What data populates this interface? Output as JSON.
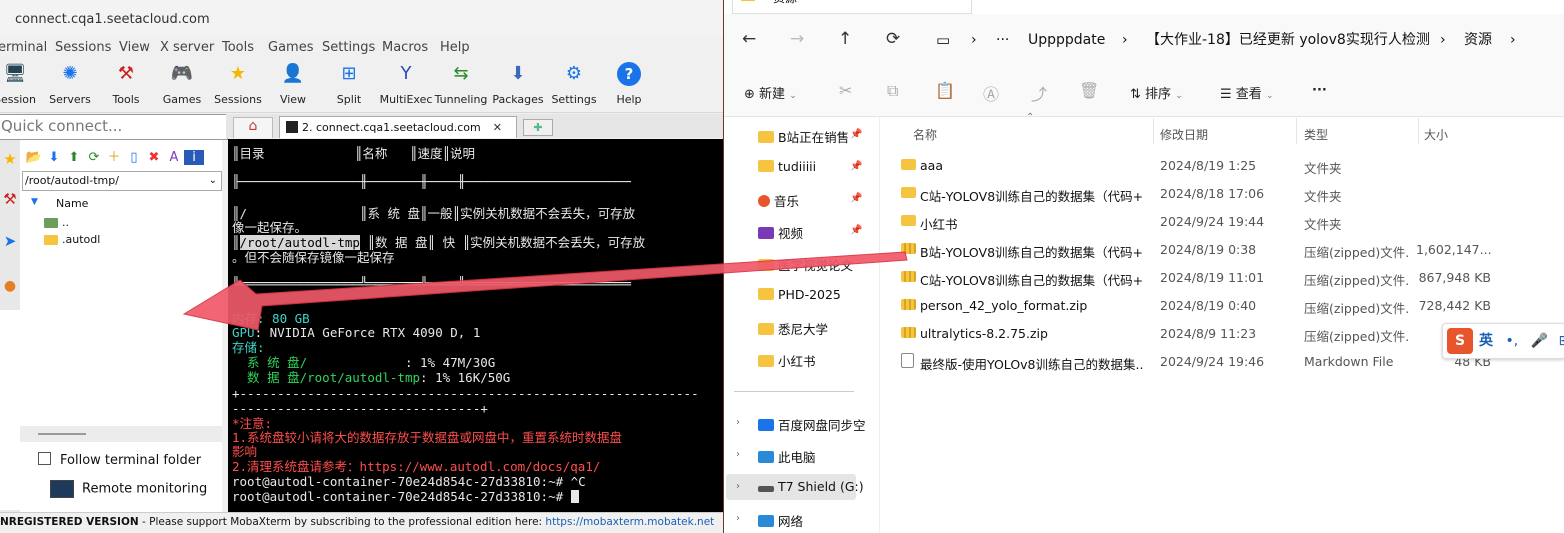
{
  "moba": {
    "title": "connect.cqa1.seetacloud.com",
    "menu": [
      "erminal",
      "Sessions",
      "View",
      "X server",
      "Tools",
      "Games",
      "Settings",
      "Macros",
      "Help"
    ],
    "toolbar": [
      {
        "label": "Session",
        "icon": "session-icon"
      },
      {
        "label": "Servers",
        "icon": "servers-icon"
      },
      {
        "label": "Tools",
        "icon": "tools-icon"
      },
      {
        "label": "Games",
        "icon": "games-icon"
      },
      {
        "label": "Sessions",
        "icon": "star-icon"
      },
      {
        "label": "View",
        "icon": "view-icon"
      },
      {
        "label": "Split",
        "icon": "split-icon"
      },
      {
        "label": "MultiExec",
        "icon": "multiexec-icon"
      },
      {
        "label": "Tunneling",
        "icon": "tunneling-icon"
      },
      {
        "label": "Packages",
        "icon": "packages-icon"
      },
      {
        "label": "Settings",
        "icon": "settings-icon"
      },
      {
        "label": "Help",
        "icon": "help-icon"
      }
    ],
    "quick_connect_placeholder": "Quick connect...",
    "sftp": {
      "path": "/root/autodl-tmp/",
      "column_name": "Name",
      "items": [
        "..",
        ".autodl"
      ],
      "follow_label": "Follow terminal folder",
      "remote_label": "Remote monitoring"
    },
    "tab_label": "2. connect.cqa1.seetacloud.com",
    "terminal": {
      "header": "║目录            ║名称   ║速度║说明",
      "sep1": "╟────────────────╫───────╫────╫──────────────────────",
      "row1a": "║/               ║系 统 盘║一般║实例关机数据不会丢失，可存放",
      "row1b": "像一起保存。",
      "row2a_path": "/root/autodl-tmp",
      "row2a_rest": "║数 据 盘║ 快 ║实例关机数据不会丢失，可存放",
      "row2b": "。但不会随保存镜像一起保存",
      "sep2": "╚════════════════╩═══════╩════╩══════════════════════",
      "mem": "内存: 80 GB",
      "gpu_label": "GPU",
      "gpu": ": NVIDIA GeForce RTX 4090 D, 1",
      "storage": "存储:",
      "sys_disk": "  系 统 盘/",
      "sys_usage": "             : 1% 47M/30G",
      "data_disk": "  数 据 盘/root/autodl-tmp",
      "data_usage": ": 1% 16K/50G",
      "sep3": "+-------------------------------------------------------------",
      "sep4": "---------------------------------+",
      "note_title": "*注意:",
      "note1": "1.系统盘较小请将大的数据存放于数据盘或网盘中，重置系统时数据盘",
      "note1b": "影响",
      "note2": "2.清理系统盘请参考：https://www.autodl.com/docs/qa1/",
      "prompt1": "root@autodl-container-70e24d854c-27d33810:~# ^C",
      "prompt2": "root@autodl-container-70e24d854c-27d33810:~# "
    },
    "status_prefix": "NREGISTERED VERSION",
    "status_text": "  -  Please support MobaXterm by subscribing to the professional edition here:",
    "status_link": "https://mobaxterm.mobatek.net"
  },
  "explorer": {
    "tab_title": "资源",
    "breadcrumb": [
      "Uppppdate",
      "【大作业-18】已经更新 yolov8实现行人检测",
      "资源"
    ],
    "commands": {
      "new": "新建",
      "sort": "排序",
      "view": "查看",
      "more": "···"
    },
    "nav": [
      {
        "label": "B站正在销售",
        "pinned": true
      },
      {
        "label": "tudiiiii",
        "pinned": true
      },
      {
        "label": "音乐",
        "pinned": true
      },
      {
        "label": "视频",
        "pinned": true
      },
      {
        "label": "医学视觉论文",
        "pinned": false
      },
      {
        "label": "PHD-2025",
        "pinned": false
      },
      {
        "label": "悉尼大学",
        "pinned": false
      },
      {
        "label": "小红书",
        "pinned": false
      }
    ],
    "nav2": [
      "百度网盘同步空",
      "此电脑",
      "T7 Shield (G:)",
      "网络"
    ],
    "columns": {
      "name": "名称",
      "date": "修改日期",
      "type": "类型",
      "size": "大小"
    },
    "files": [
      {
        "name": "aaa",
        "date": "2024/8/19 1:25",
        "type": "文件夹",
        "size": "",
        "kind": "folder"
      },
      {
        "name": "C站-YOLOV8训练自己的数据集（代码+...",
        "date": "2024/8/18 17:06",
        "type": "文件夹",
        "size": "",
        "kind": "folder"
      },
      {
        "name": "小红书",
        "date": "2024/9/24 19:44",
        "type": "文件夹",
        "size": "",
        "kind": "folder"
      },
      {
        "name": "B站-YOLOV8训练自己的数据集（代码+...",
        "date": "2024/8/19 0:38",
        "type": "压缩(zipped)文件...",
        "size": "1,602,147...",
        "kind": "zip"
      },
      {
        "name": "C站-YOLOV8训练自己的数据集（代码+...",
        "date": "2024/8/19 11:01",
        "type": "压缩(zipped)文件...",
        "size": "867,948 KB",
        "kind": "zip"
      },
      {
        "name": "person_42_yolo_format.zip",
        "date": "2024/8/19 0:40",
        "type": "压缩(zipped)文件...",
        "size": "728,442 KB",
        "kind": "zip"
      },
      {
        "name": "ultralytics-8.2.75.zip",
        "date": "2024/8/9 11:23",
        "type": "压缩(zipped)文件...",
        "size": "",
        "kind": "zip"
      },
      {
        "name": "最终版-使用YOLOv8训练自己的数据集...",
        "date": "2024/9/24 19:46",
        "type": "Markdown File",
        "size": "48 KB",
        "kind": "md"
      }
    ],
    "ime": {
      "logo": "S",
      "lang": "英"
    }
  },
  "colors": {
    "terminal_bg": "#000000",
    "terminal_cyan": "#3cd6c8",
    "terminal_green": "#2fd45b",
    "terminal_red": "#ff4d4d",
    "arrow": "#f0596a"
  }
}
